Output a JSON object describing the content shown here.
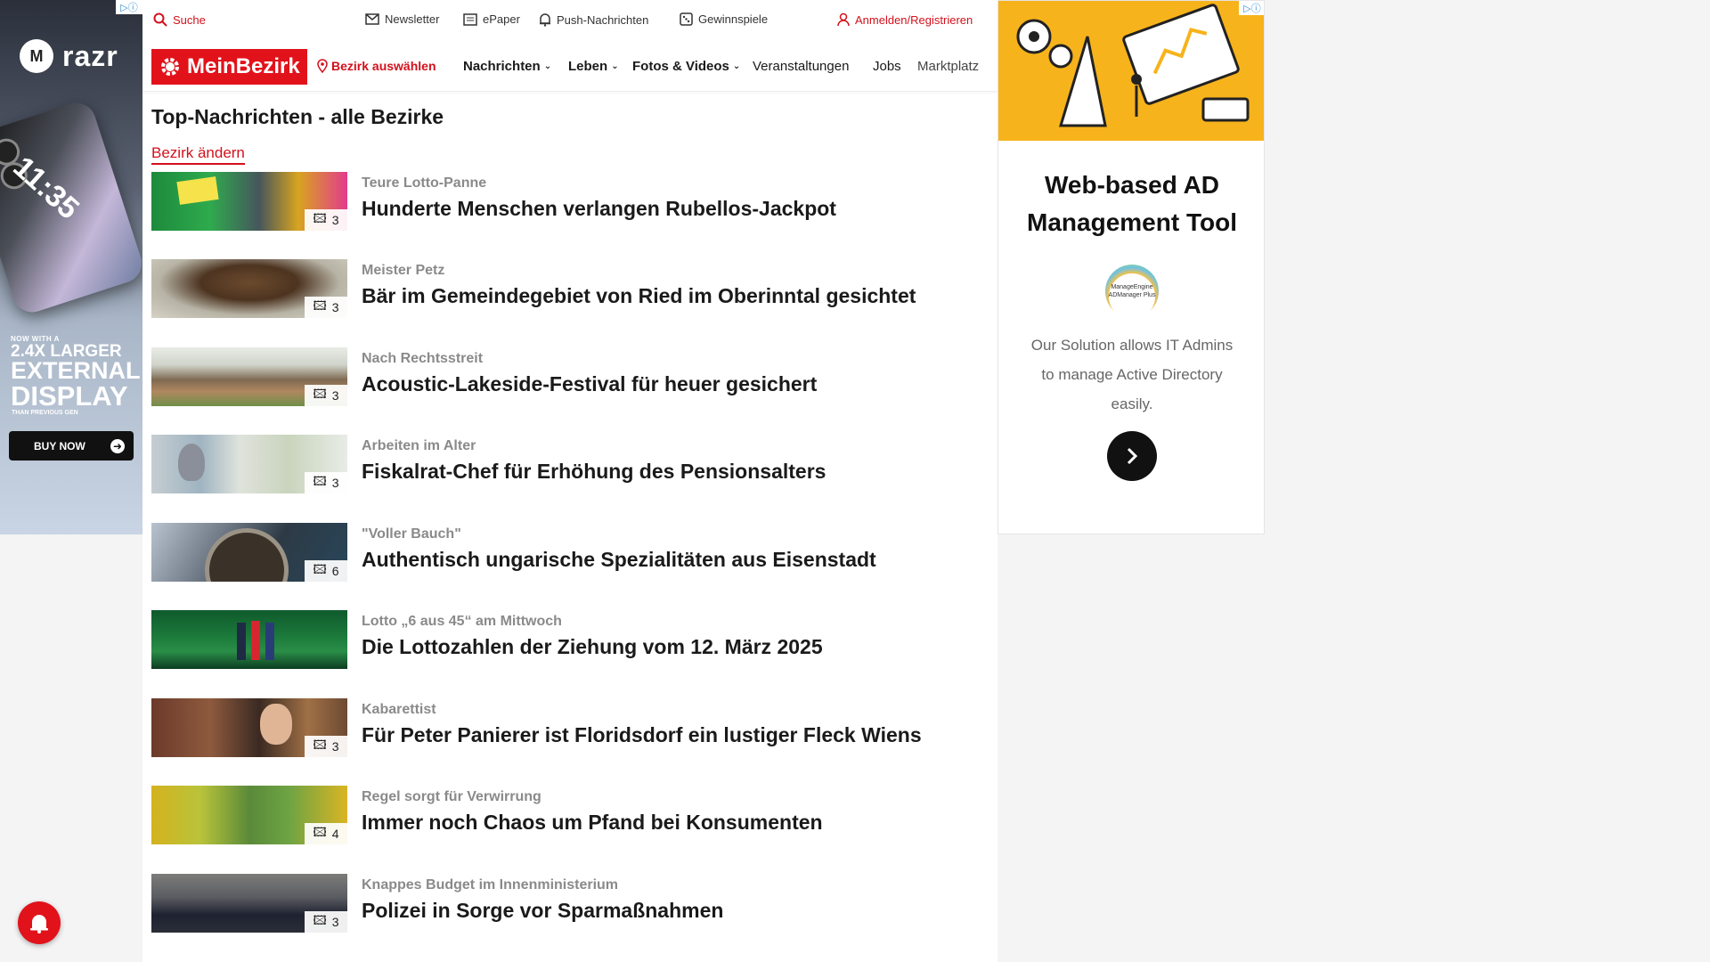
{
  "left_ad": {
    "brand_initial": "M",
    "brand_name": "razr",
    "phone_time": "11:35",
    "small_text": "NOW WITH A",
    "big_line1": "2.4X LARGER",
    "big_line2": "EXTERNAL",
    "big_line3": "DISPLAY",
    "sub_text": "THAN PREVIOUS GEN",
    "cta_label": "BUY NOW"
  },
  "topbar": {
    "search_label": "Suche",
    "newsletter_label": "Newsletter",
    "epaper_label": "ePaper",
    "push_label": "Push-Nachrichten",
    "games_label": "Gewinnspiele",
    "login_label": "Anmelden/Registrieren"
  },
  "navbar": {
    "logo_text": "MeinBezirk",
    "district_label": "Bezirk auswählen",
    "items": [
      {
        "label": "Nachrichten"
      },
      {
        "label": "Leben"
      },
      {
        "label": "Fotos & Videos"
      },
      {
        "label": "Veranstaltungen"
      },
      {
        "label": "Jobs"
      },
      {
        "label": "Marktplatz"
      }
    ]
  },
  "page": {
    "title": "Top-Nachrichten - alle Bezirke",
    "change_district": "Bezirk ändern"
  },
  "articles": [
    {
      "kicker": "Teure Lotto-Panne",
      "headline": "Hunderte Menschen verlangen Rubellos-Jackpot",
      "photos": "3"
    },
    {
      "kicker": "Meister Petz",
      "headline": "Bär im Gemeindegebiet von Ried im Oberinntal gesichtet",
      "photos": "3"
    },
    {
      "kicker": "Nach Rechtsstreit",
      "headline": "Acoustic-Lakeside-Festival für heuer gesichert",
      "photos": "3"
    },
    {
      "kicker": "Arbeiten im Alter",
      "headline": "Fiskalrat-Chef für Erhöhung des Pensionsalters",
      "photos": "3"
    },
    {
      "kicker": "\"Voller Bauch\"",
      "headline": "Authentisch ungarische Spezialitäten aus Eisenstadt",
      "photos": "6"
    },
    {
      "kicker": "Lotto „6 aus 45“ am Mittwoch",
      "headline": "Die Lottozahlen der Ziehung vom 12. März 2025",
      "photos": ""
    },
    {
      "kicker": "Kabarettist",
      "headline": "Für Peter Panierer ist Floridsdorf ein lustiger Fleck Wiens",
      "photos": "3"
    },
    {
      "kicker": "Regel sorgt für Verwirrung",
      "headline": "Immer noch Chaos um Pfand bei Konsumenten",
      "photos": "4"
    },
    {
      "kicker": "Knappes Budget im Innenministerium",
      "headline": "Polizei in Sorge vor Sparmaßnahmen",
      "photos": "3"
    }
  ],
  "right_ad": {
    "title_line1": "Web-based AD",
    "title_line2": "Management Tool",
    "logo_line1": "ManageEngine",
    "logo_line2": "ADManager Plus",
    "desc_line1": "Our Solution allows IT Admins",
    "desc_line2": "to manage Active Directory",
    "desc_line3": "easily."
  },
  "colors": {
    "brand_red": "#e2121b",
    "link_red": "#d3101c",
    "ad_yellow": "#f7b31c"
  }
}
